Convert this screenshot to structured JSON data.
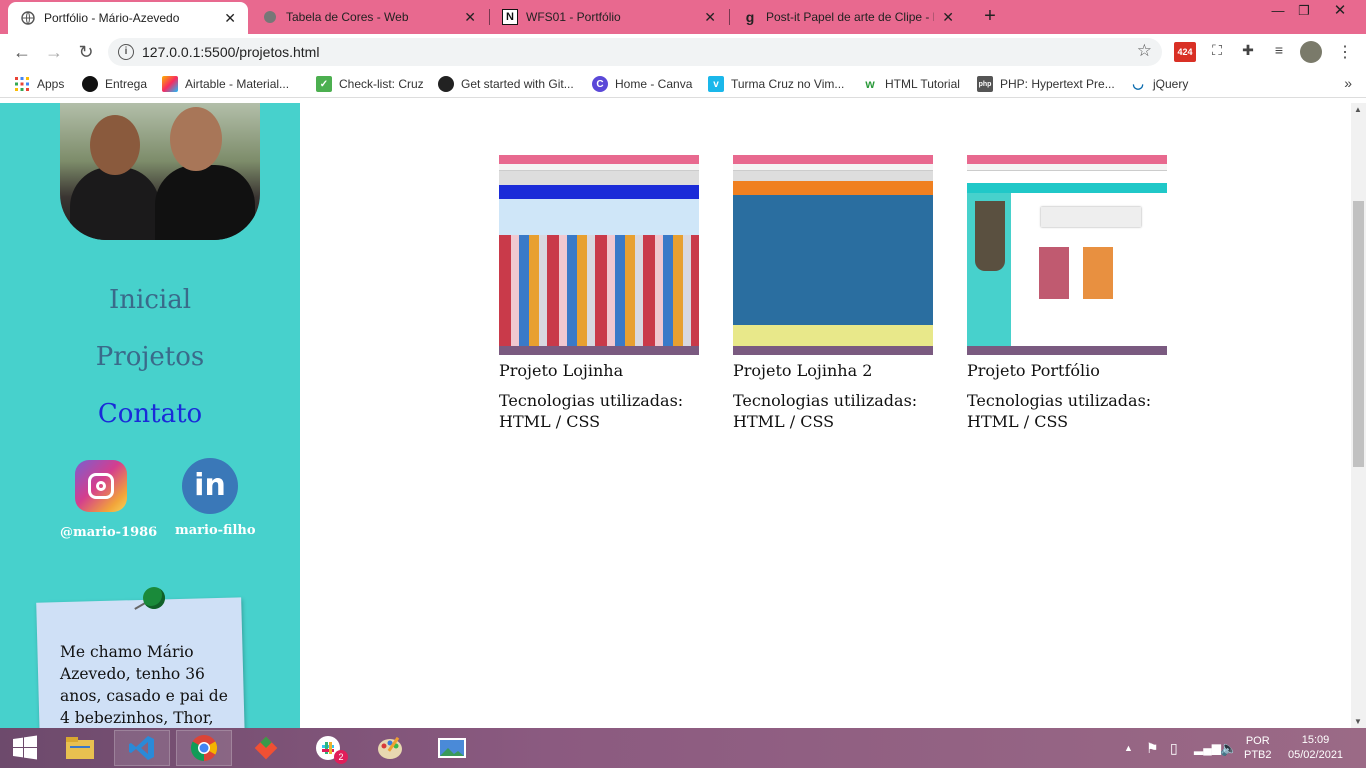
{
  "browser": {
    "tabs": [
      {
        "title": "Portfólio - Mário-Azevedo",
        "active": true
      },
      {
        "title": "Tabela de Cores - Web",
        "active": false
      },
      {
        "title": "WFS01 - Portfólio",
        "active": false
      },
      {
        "title": "Post-it Papel de arte de Clipe - Pi",
        "active": false
      }
    ],
    "url": "127.0.0.1:5500/projetos.html",
    "gmail_count": "424",
    "bookmarks": [
      "Apps",
      "Entrega",
      "Airtable - Material...",
      "Check-list: Cruz",
      "Get started with Git...",
      "Home - Canva",
      "Turma Cruz no Vim...",
      "HTML Tutorial",
      "PHP: Hypertext Pre...",
      "jQuery"
    ]
  },
  "sidebar": {
    "nav": [
      "Inicial",
      "Projetos",
      "Contato"
    ],
    "social": {
      "instagram": "@mario-1986",
      "linkedin": "mario-filho",
      "linkedin_glyph": "in"
    },
    "about_text": "Me chamo Mário Azevedo, tenho 36 anos, casado e pai de 4 bebezinhos, Thor,"
  },
  "projects": [
    {
      "title": "Projeto Lojinha",
      "tech_label": "Tecnologias utilizadas:",
      "tech": "HTML / CSS"
    },
    {
      "title": "Projeto Lojinha 2",
      "tech_label": "Tecnologias utilizadas:",
      "tech": "HTML / CSS"
    },
    {
      "title": "Projeto Portfólio",
      "tech_label": "Tecnologias utilizadas:",
      "tech": "HTML / CSS"
    }
  ],
  "taskbar": {
    "lang": "POR",
    "layout": "PTB2",
    "time": "15:09",
    "date": "05/02/2021",
    "slack_badge": "2"
  },
  "colors": {
    "tab_bar": "#e8698f",
    "sidebar": "#47d1cc",
    "active_nav": "#1a2bd8"
  }
}
